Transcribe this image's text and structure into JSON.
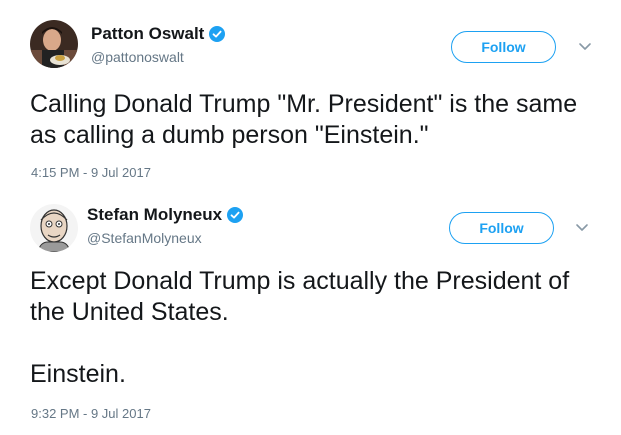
{
  "tweets": [
    {
      "name": "Patton Oswalt",
      "handle": "@pattonoswalt",
      "follow_label": "Follow",
      "text": "Calling Donald Trump \"Mr. President\" is the same as calling a dumb person \"Einstein.\"",
      "timestamp": "4:15 PM - 9 Jul 2017"
    },
    {
      "name": "Stefan Molyneux",
      "handle": "@StefanMolyneux",
      "follow_label": "Follow",
      "text": "Except Donald Trump is actually the President of the United States.\n\nEinstein.",
      "timestamp": "9:32 PM - 9 Jul 2017"
    }
  ],
  "colors": {
    "accent": "#1da1f2",
    "text": "#14171a",
    "muted": "#657786"
  },
  "icons": {
    "verified": "verified-badge-icon",
    "menu": "chevron-down-icon"
  }
}
